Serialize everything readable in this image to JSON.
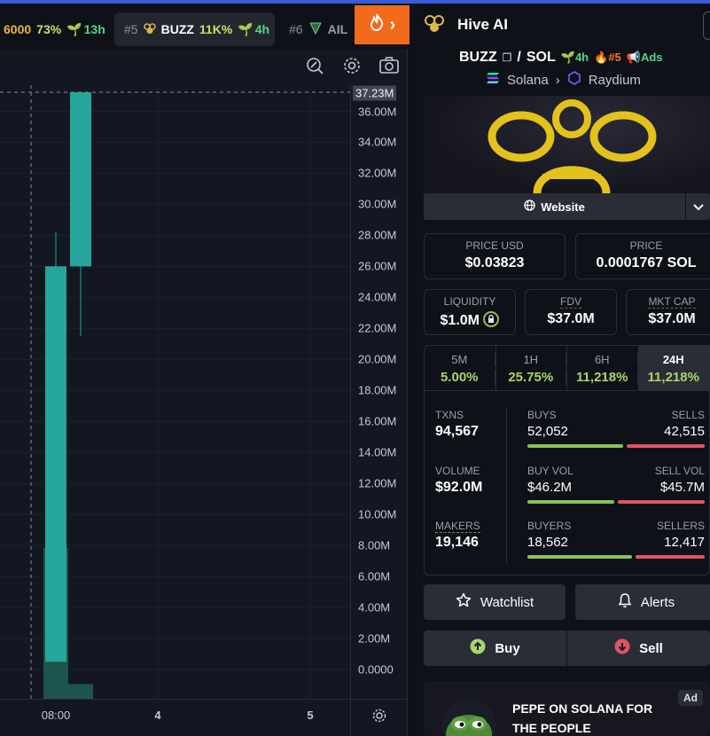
{
  "ticker": [
    {
      "amount": "6000",
      "pct": "73%",
      "age": "13h"
    },
    {
      "rank": "#5",
      "symbol": "BUZZ",
      "pct": "11K%",
      "age": "4h"
    },
    {
      "rank": "#6",
      "symbol": "AIL"
    }
  ],
  "hive": {
    "title": "Hive AI"
  },
  "chart_tools": [
    "measure-icon",
    "gear-icon",
    "camera-icon"
  ],
  "chart_data": {
    "type": "candlestick",
    "y_ticks": [
      "36.00M",
      "34.00M",
      "32.00M",
      "30.00M",
      "28.00M",
      "26.00M",
      "24.00M",
      "22.00M",
      "20.00M",
      "18.00M",
      "16.00M",
      "14.00M",
      "12.00M",
      "10.00M",
      "8.00M",
      "6.00M",
      "4.00M",
      "2.00M",
      "0.0000"
    ],
    "current_price_label": "37.23M",
    "x_ticks": [
      "08:00",
      "4",
      "5"
    ],
    "ylim": [
      0,
      37.23
    ],
    "candles": [
      {
        "open": 0.5,
        "close": 26.0,
        "high": 28.2,
        "low": 0.5
      },
      {
        "open": 26.0,
        "close": 37.23,
        "high": 37.23,
        "low": 21.5
      }
    ],
    "volume": [
      8.2,
      0.8
    ]
  },
  "pair": {
    "base": "BUZZ",
    "sep": "/",
    "quote": "SOL",
    "age": "4h",
    "rank": "#5",
    "ads": "Ads"
  },
  "chain": {
    "name": "Solana",
    "dex": "Raydium"
  },
  "website_label": "Website",
  "metrics": {
    "price_usd": {
      "label": "PRICE USD",
      "value": "$0.03823"
    },
    "price": {
      "label": "PRICE",
      "value": "0.0001767 SOL"
    },
    "liquidity": {
      "label": "LIQUIDITY",
      "value": "$1.0M"
    },
    "fdv": {
      "label": "FDV",
      "value": "$37.0M"
    },
    "mkt_cap": {
      "label": "MKT CAP",
      "value": "$37.0M"
    }
  },
  "timeframes": [
    {
      "label": "5M",
      "value": "5.00%"
    },
    {
      "label": "1H",
      "value": "25.75%"
    },
    {
      "label": "6H",
      "value": "11,218%"
    },
    {
      "label": "24H",
      "value": "11,218%"
    }
  ],
  "stats": {
    "txns": {
      "label": "TXNS",
      "value": "94,567",
      "left_label": "BUYS",
      "left_value": "52,052",
      "right_label": "SELLS",
      "right_value": "42,515",
      "left_frac": 0.55
    },
    "volume": {
      "label": "VOLUME",
      "value": "$92.0M",
      "left_label": "BUY VOL",
      "left_value": "$46.2M",
      "right_label": "SELL VOL",
      "right_value": "$45.7M",
      "left_frac": 0.5
    },
    "makers": {
      "label": "MAKERS",
      "value": "19,146",
      "left_label": "BUYERS",
      "left_value": "18,562",
      "right_label": "SELLERS",
      "right_value": "12,417",
      "left_frac": 0.6
    }
  },
  "buttons": {
    "watchlist": "Watchlist",
    "alerts": "Alerts",
    "buy": "Buy",
    "sell": "Sell"
  },
  "ad": {
    "title": "PEPE ON SOLANA FOR THE PEOPLE",
    "badge": "Ad"
  }
}
